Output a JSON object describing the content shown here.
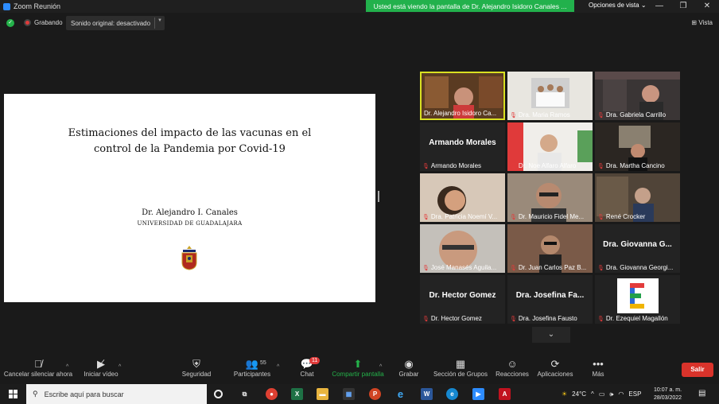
{
  "window": {
    "title": "Zoom Reunión",
    "share_banner": "Usted está viendo la pantalla de Dr. Alejandro Isidoro Canales ...",
    "view_options": "Opciones de vista",
    "minimize": "—",
    "restore": "❐",
    "close": "✕"
  },
  "meeting_bar": {
    "recording": "Grabando",
    "original_sound": "Sonido original: desactivado",
    "view": "Vista"
  },
  "slide": {
    "title_line1": "Estimaciones del impacto de las vacunas en el",
    "title_line2": "control de la Pandemia por Covid-19",
    "author": "Dr. Alejandro I. Canales",
    "university": "UNIVERSIDAD DE GUADALAJARA"
  },
  "participants": [
    {
      "name": "Dr. Alejandro Isidoro Ca...",
      "big": "",
      "muted": false,
      "photo": "bookshelf",
      "active": true
    },
    {
      "name": "Dra. Maria Ramos",
      "big": "",
      "muted": true,
      "photo": "group",
      "active": false
    },
    {
      "name": "Dra. Gabriela Carrillo",
      "big": "",
      "muted": true,
      "photo": "office",
      "active": false
    },
    {
      "name": "Armando Morales",
      "big": "Armando Morales",
      "muted": true,
      "photo": "",
      "active": false
    },
    {
      "name": "Dr. Noe Alfaro Alfaro",
      "big": "",
      "muted": true,
      "photo": "bright",
      "active": false
    },
    {
      "name": "Dra. Martha Cancino",
      "big": "",
      "muted": true,
      "photo": "dark-room",
      "active": false
    },
    {
      "name": "Dra. Patricia Noemí V...",
      "big": "",
      "muted": true,
      "photo": "woman",
      "active": false
    },
    {
      "name": "Dr. Mauricio Fidel Me...",
      "big": "",
      "muted": true,
      "photo": "man-glasses",
      "active": false
    },
    {
      "name": "René Crocker",
      "big": "",
      "muted": true,
      "photo": "library",
      "active": false
    },
    {
      "name": "José Manasés Aguila...",
      "big": "",
      "muted": true,
      "photo": "man-close",
      "active": false
    },
    {
      "name": "Dr. Juan Carlos Paz B...",
      "big": "",
      "muted": true,
      "photo": "man-wall",
      "active": false
    },
    {
      "name": "Dra. Giovanna Georgi...",
      "big": "Dra. Giovanna G...",
      "muted": true,
      "photo": "",
      "active": false
    },
    {
      "name": "Dr. Hector Gomez",
      "big": "Dr. Hector Gomez",
      "muted": true,
      "photo": "",
      "active": false
    },
    {
      "name": "Dra. Josefina Fausto",
      "big": "Dra. Josefina Fa...",
      "muted": true,
      "photo": "",
      "active": false
    },
    {
      "name": "Dr. Ezequiel Magallón",
      "big": "",
      "muted": true,
      "photo": "logo-e",
      "active": false
    }
  ],
  "toolbar": {
    "mute": "Cancelar silenciar ahora",
    "video": "Iniciar vídeo",
    "security": "Seguridad",
    "participants": "Participantes",
    "participants_count": "55",
    "chat": "Chat",
    "chat_badge": "11",
    "share": "Compartir pantalla",
    "record": "Grabar",
    "breakout": "Sección de Grupos",
    "reactions": "Reacciones",
    "apps": "Aplicaciones",
    "more": "Más",
    "leave": "Salir"
  },
  "taskbar": {
    "search_placeholder": "Escribe aquí para buscar",
    "temperature": "24°C",
    "language": "ESP",
    "time": "10:07 a. m.",
    "date": "28/03/2022"
  },
  "colors": {
    "share_green": "#22b14c",
    "active_border": "#d9e022",
    "leave_red": "#d9332b"
  }
}
